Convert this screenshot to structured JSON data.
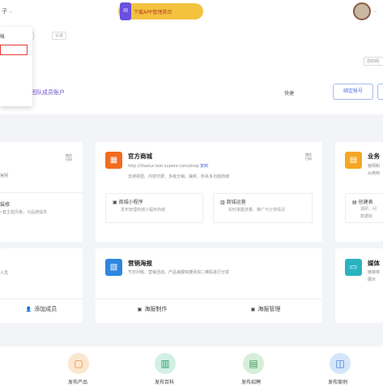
{
  "topbar": {
    "left_text": "子",
    "banner_text": "下载APP管理首页",
    "phone_glyph": "✉"
  },
  "dropdown": {
    "items": [
      "帐",
      "",
      "",
      "",
      "",
      ""
    ]
  },
  "profile": {
    "tags": [
      "",
      "认证"
    ],
    "right_tag": "您的网",
    "team_link": "团队成员账户",
    "quick_label": "快捷",
    "buttons": [
      "绑定帐号",
      ""
    ]
  },
  "cards": {
    "mall": {
      "title": "官方商城",
      "url": "http://XiaoLe.test.supenr.com/shop",
      "url_link": "复制",
      "desc": "支持拼团、内容付费、多级分销、抽奖、秒杀多功能商城",
      "qr": "微信 扫码",
      "sub1_title": "商城小程序",
      "sub1_desc": "发布管理商城小程序商城",
      "sub2_title": "商城运营",
      "sub2_desc": "实时掌握流量、推广与订单情况"
    },
    "poster": {
      "title": "营销海报",
      "desc": "节日问候、营销活动、产品海报快捷添加二维码进行分享",
      "action1": "海报制作",
      "action2": "海报管理"
    },
    "left_top": {
      "desc": "官网",
      "qr": "微信 扫码",
      "sub_title": "装修",
      "sub_desc": "•套主题风格，为品牌提供"
    },
    "left_bottom": {
      "desc": "人员",
      "action": "添加成员"
    },
    "right_top": {
      "title": "业务",
      "desc1": "官网和",
      "desc2": "从用到",
      "sub_title": "创建表",
      "sub_desc1": "调研、问",
      "sub_desc2": "数据收"
    },
    "right_bottom": {
      "title": "媒体",
      "desc1": "链接将",
      "desc2": "展示"
    }
  },
  "bottom_bar": [
    {
      "label": "发布产品",
      "icon": "product-box-icon",
      "color": "#e8b97f"
    },
    {
      "label": "发布百科",
      "icon": "book-icon",
      "color": "#4fbf9a"
    },
    {
      "label": "发布招聘",
      "icon": "recruit-icon",
      "color": "#5fbf7f"
    },
    {
      "label": "发布案例",
      "icon": "case-inbox-icon",
      "color": "#4a8ee0"
    }
  ],
  "colors": {
    "accent_purple": "#6a4fc9",
    "mall_orange": "#f26b1d",
    "poster_blue": "#2e86e0",
    "business_orange": "#f5a623",
    "media_teal": "#2bb3c0",
    "banner_yellow": "#f3c23f"
  }
}
